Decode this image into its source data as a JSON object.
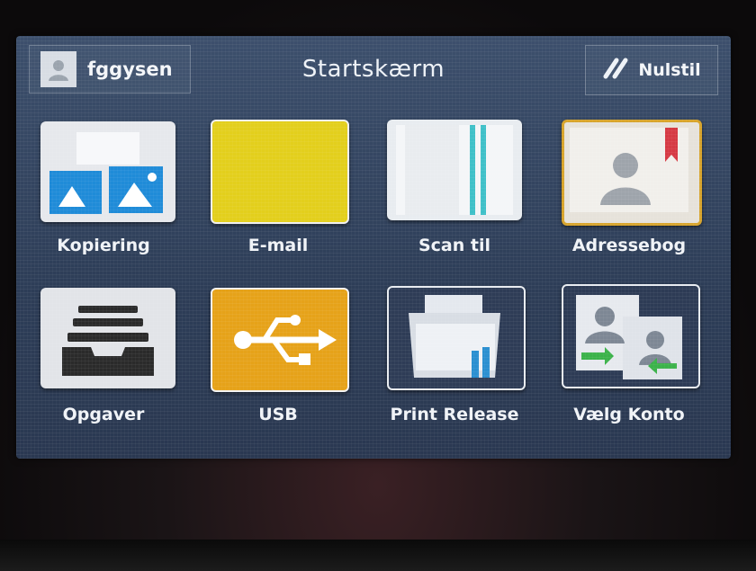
{
  "header": {
    "title": "Startskærm",
    "user_label": "fggysen",
    "reset_label": "Nulstil"
  },
  "tiles": [
    {
      "label": "Kopiering",
      "icon": "copy-icon"
    },
    {
      "label": "E-mail",
      "icon": "email-icon"
    },
    {
      "label": "Scan til",
      "icon": "scan-icon"
    },
    {
      "label": "Adressebog",
      "icon": "address-book-icon"
    },
    {
      "label": "Opgaver",
      "icon": "jobs-icon"
    },
    {
      "label": "USB",
      "icon": "usb-icon"
    },
    {
      "label": "Print Release",
      "icon": "print-release-icon"
    },
    {
      "label": "Vælg Konto",
      "icon": "select-account-icon"
    }
  ],
  "colors": {
    "screen_bg": "#3c4f6c",
    "email_tile": "#e3cf1c",
    "usb_tile": "#e6a219",
    "addressbook_border": "#d7a32a"
  }
}
